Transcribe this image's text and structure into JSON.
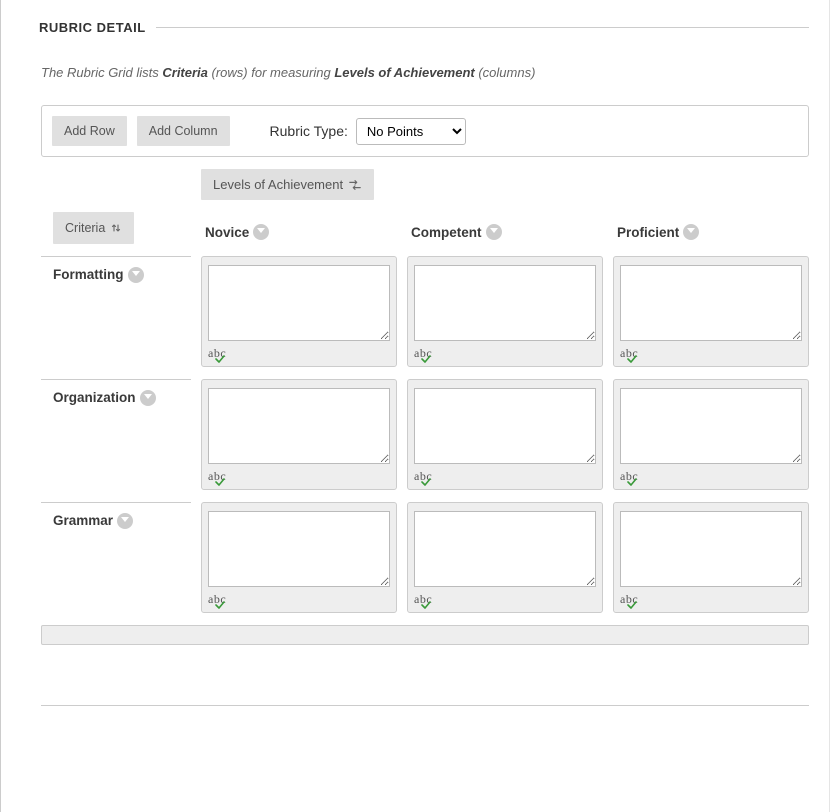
{
  "section_title": "RUBRIC DETAIL",
  "description": {
    "prefix": "The Rubric Grid lists ",
    "bold1": "Criteria",
    "mid": " (rows) for measuring ",
    "bold2": "Levels of Achievement",
    "suffix": " (columns)"
  },
  "toolbar": {
    "add_row": "Add Row",
    "add_column": "Add Column",
    "type_label": "Rubric Type:",
    "type_options": [
      "No Points"
    ],
    "type_selected": "No Points"
  },
  "grid": {
    "levels_label": "Levels of Achievement",
    "criteria_label": "Criteria",
    "columns": [
      {
        "name": "Novice"
      },
      {
        "name": "Competent"
      },
      {
        "name": "Proficient"
      }
    ],
    "rows": [
      {
        "name": "Formatting",
        "cells": [
          "",
          "",
          ""
        ]
      },
      {
        "name": "Organization",
        "cells": [
          "",
          "",
          ""
        ]
      },
      {
        "name": "Grammar",
        "cells": [
          "",
          "",
          ""
        ]
      }
    ],
    "spellcheck_label": "abc"
  }
}
